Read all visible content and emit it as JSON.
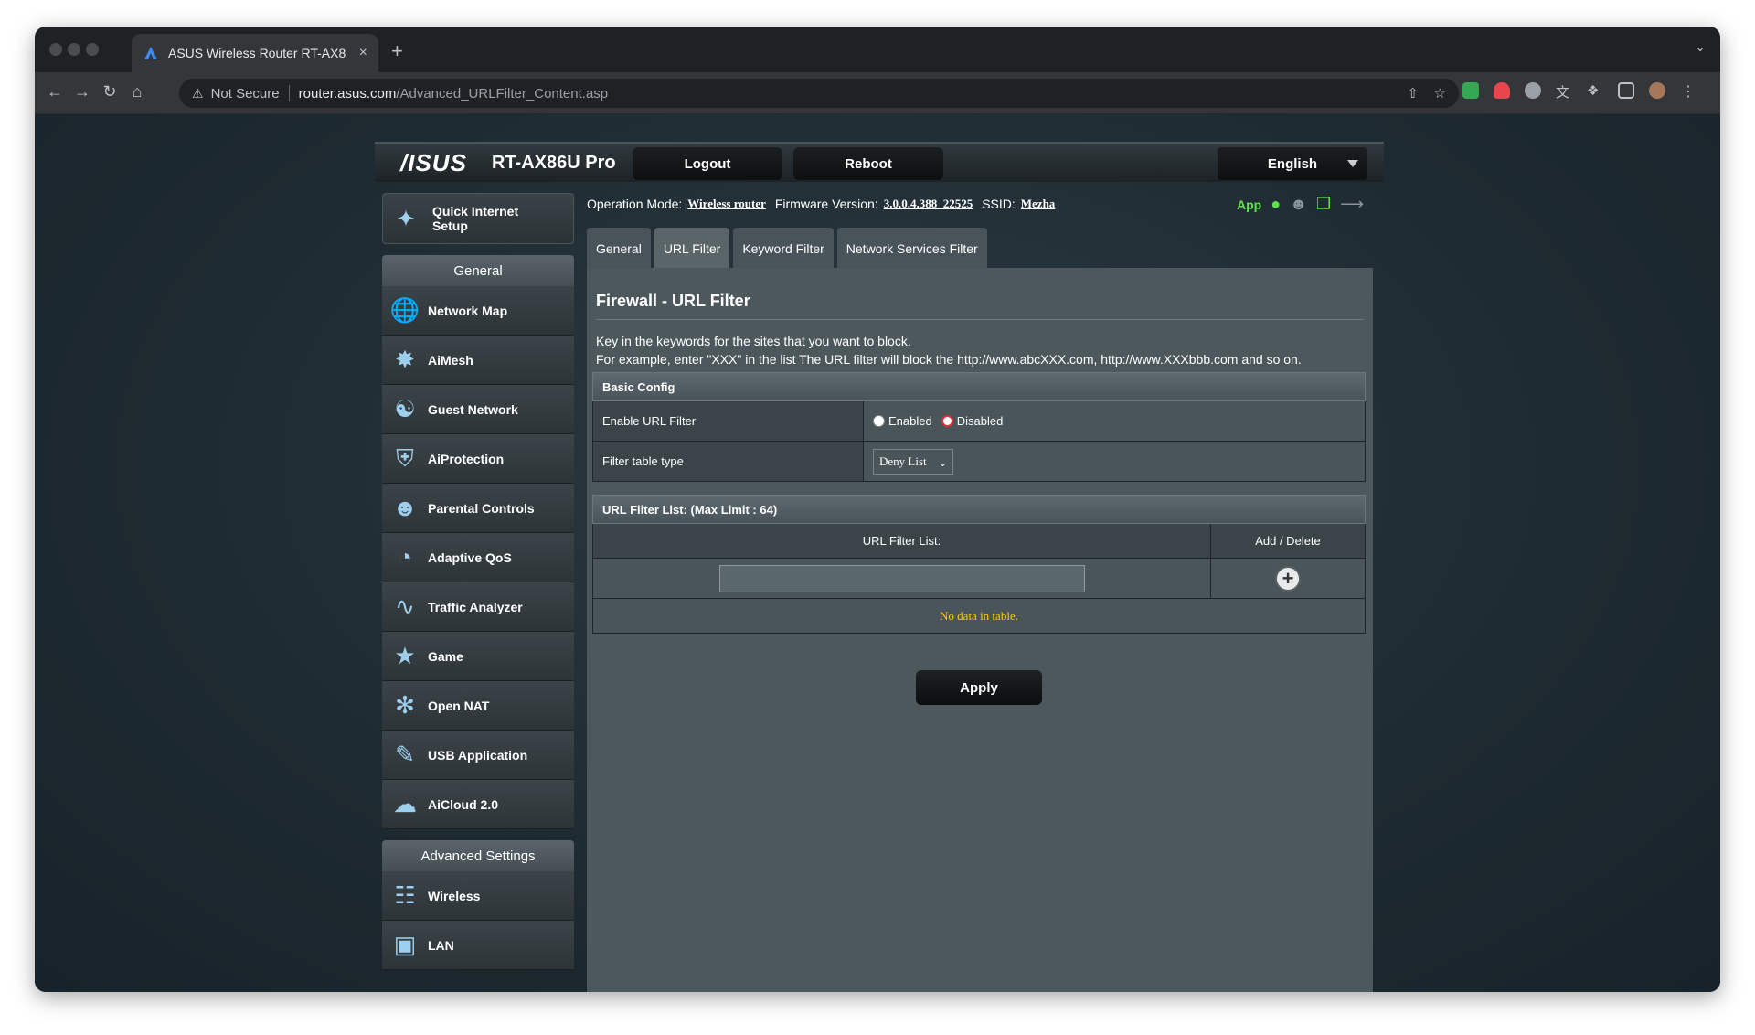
{
  "browser": {
    "tab_title": "ASUS Wireless Router RT-AX8",
    "tab_close": "×",
    "new_tab": "+",
    "security_label": "Not Secure",
    "url_host": "router.asus.com",
    "url_path": "/Advanced_URLFilter_Content.asp"
  },
  "header": {
    "logo": "/ISUS",
    "model": "RT-AX86U Pro",
    "logout_label": "Logout",
    "reboot_label": "Reboot",
    "language": "English"
  },
  "sidebar": {
    "qis_label": "Quick Internet Setup",
    "general_heading": "General",
    "general_items": [
      {
        "label": "Network Map",
        "icon": "globe-icon"
      },
      {
        "label": "AiMesh",
        "icon": "mesh-icon"
      },
      {
        "label": "Guest Network",
        "icon": "guest-globe-icon"
      },
      {
        "label": "AiProtection",
        "icon": "lock-shield-icon"
      },
      {
        "label": "Parental Controls",
        "icon": "family-icon"
      },
      {
        "label": "Adaptive QoS",
        "icon": "speedometer-icon"
      },
      {
        "label": "Traffic Analyzer",
        "icon": "waveform-icon"
      },
      {
        "label": "Game",
        "icon": "gamepad-icon"
      },
      {
        "label": "Open NAT",
        "icon": "network-globe-icon"
      },
      {
        "label": "USB Application",
        "icon": "usb-icon"
      },
      {
        "label": "AiCloud 2.0",
        "icon": "cloud-icon"
      }
    ],
    "advanced_heading": "Advanced Settings",
    "advanced_items": [
      {
        "label": "Wireless",
        "icon": "wifi-icon"
      },
      {
        "label": "LAN",
        "icon": "lan-icon"
      }
    ]
  },
  "status": {
    "operation_mode_label": "Operation Mode:",
    "operation_mode_value": "Wireless router",
    "firmware_label": "Firmware Version:",
    "firmware_value": "3.0.0.4.388_22525",
    "ssid_label": "SSID:",
    "ssid_value": "Mezha",
    "app_label": "App",
    "accent": "#5fe04a"
  },
  "tabs": [
    {
      "label": "General"
    },
    {
      "label": "URL Filter"
    },
    {
      "label": "Keyword Filter"
    },
    {
      "label": "Network Services Filter"
    }
  ],
  "content": {
    "title": "Firewall - URL Filter",
    "desc1": "Key in the keywords for the sites that you want to block.",
    "desc2": "For example, enter \"XXX\" in the list The URL filter will block the http://www.abcXXX.com, http://www.XXXbbb.com and so on.",
    "basic_config_heading": "Basic Config",
    "enable_label": "Enable URL Filter",
    "enabled_option": "Enabled",
    "disabled_option": "Disabled",
    "selected_option": "Disabled",
    "filter_type_label": "Filter table type",
    "filter_type_value": "Deny List",
    "list_heading": "URL Filter List: (Max Limit : 64)",
    "list_col_label": "URL Filter List:",
    "list_col_action": "Add / Delete",
    "url_input_value": "",
    "no_data": "No data in table.",
    "apply_label": "Apply"
  }
}
